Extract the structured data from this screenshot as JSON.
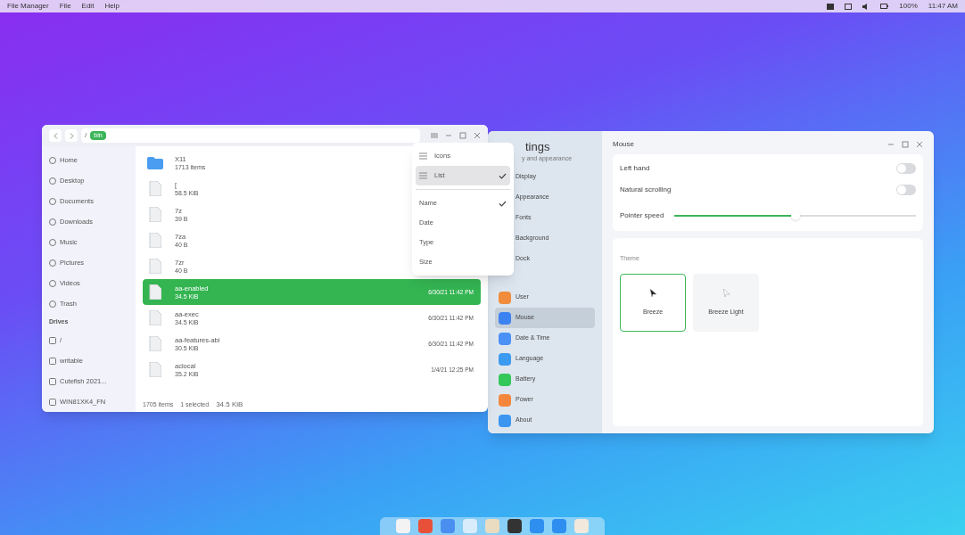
{
  "top_bar": {
    "app_menu": "File Manager",
    "menus": [
      "File",
      "Edit",
      "Help"
    ],
    "battery": "100%",
    "clock": "11:47 AM"
  },
  "file_manager": {
    "path_root": "/",
    "path_current": "bin",
    "sidebar": [
      {
        "kind": "item",
        "label": "Home"
      },
      {
        "kind": "item",
        "label": "Desktop"
      },
      {
        "kind": "item",
        "label": "Documents"
      },
      {
        "kind": "item",
        "label": "Downloads"
      },
      {
        "kind": "item",
        "label": "Music"
      },
      {
        "kind": "item",
        "label": "Pictures"
      },
      {
        "kind": "item",
        "label": "Videos"
      },
      {
        "kind": "item",
        "label": "Trash"
      },
      {
        "kind": "heading",
        "label": "Drives"
      },
      {
        "kind": "drive",
        "label": "/"
      },
      {
        "kind": "drive",
        "label": "writable"
      },
      {
        "kind": "drive",
        "label": "Cutefish 2021..."
      },
      {
        "kind": "drive",
        "label": "WIN81XK4_FN"
      }
    ],
    "files": [
      {
        "kind": "folder",
        "name": "X11",
        "info": "1713 items",
        "selected": false
      },
      {
        "kind": "file",
        "name": "[",
        "info": "58.5 KiB",
        "selected": false
      },
      {
        "kind": "file",
        "name": "7z",
        "info": "39 B",
        "selected": false
      },
      {
        "kind": "file",
        "name": "7za",
        "info": "40 B",
        "selected": false
      },
      {
        "kind": "file",
        "name": "7zr",
        "info": "40 B",
        "selected": false
      },
      {
        "kind": "file",
        "name": "aa-enabled",
        "info": "34.5 KiB",
        "date": "6/30/21 11:42 PM",
        "selected": true
      },
      {
        "kind": "file",
        "name": "aa-exec",
        "info": "34.5 KiB",
        "date": "6/30/21 11:42 PM",
        "selected": false
      },
      {
        "kind": "file",
        "name": "aa-features-abi",
        "info": "30.5 KiB",
        "date": "6/30/21 11:42 PM",
        "selected": false
      },
      {
        "kind": "file",
        "name": "aclocal",
        "info": "35.2 KiB",
        "date": "1/4/21 12:25 PM",
        "selected": false
      }
    ],
    "status": {
      "count": "1705 items",
      "selected": "1 selected",
      "size": "34.5 KiB"
    }
  },
  "view_menu": {
    "views": [
      {
        "label": "Icons",
        "checked": false
      },
      {
        "label": "List",
        "checked": true
      }
    ],
    "sort": [
      {
        "label": "Name",
        "checked": true
      },
      {
        "label": "Date",
        "checked": false
      },
      {
        "label": "Type",
        "checked": false
      },
      {
        "label": "Size",
        "checked": false
      }
    ]
  },
  "settings": {
    "title": "tings",
    "section": "y and appearance",
    "items": [
      {
        "label": "Display",
        "selected": false
      },
      {
        "label": "Appearance",
        "selected": false
      },
      {
        "label": "Fonts",
        "selected": false
      },
      {
        "label": "Background",
        "selected": false
      },
      {
        "label": "Dock",
        "selected": false
      },
      {
        "label": "User",
        "selected": false,
        "color": "#f08c3c"
      },
      {
        "label": "Mouse",
        "selected": true,
        "color": "#3c82f0"
      },
      {
        "label": "Date & Time",
        "selected": false,
        "color": "#4a90f5"
      },
      {
        "label": "Language",
        "selected": false,
        "color": "#3c9af0"
      },
      {
        "label": "Battery",
        "selected": false,
        "color": "#34c759"
      },
      {
        "label": "Power",
        "selected": false,
        "color": "#f5873c"
      },
      {
        "label": "About",
        "selected": false,
        "color": "#3c96f0"
      }
    ],
    "page_title": "Mouse",
    "toggles": [
      {
        "label": "Left hand",
        "on": false
      },
      {
        "label": "Natural scrolling",
        "on": false
      }
    ],
    "slider": {
      "label": "Pointer speed",
      "level": 0.5
    },
    "theme": {
      "label": "Theme",
      "options": [
        {
          "label": "Breeze",
          "selected": true
        },
        {
          "label": "Breeze Light",
          "selected": false
        }
      ]
    }
  }
}
